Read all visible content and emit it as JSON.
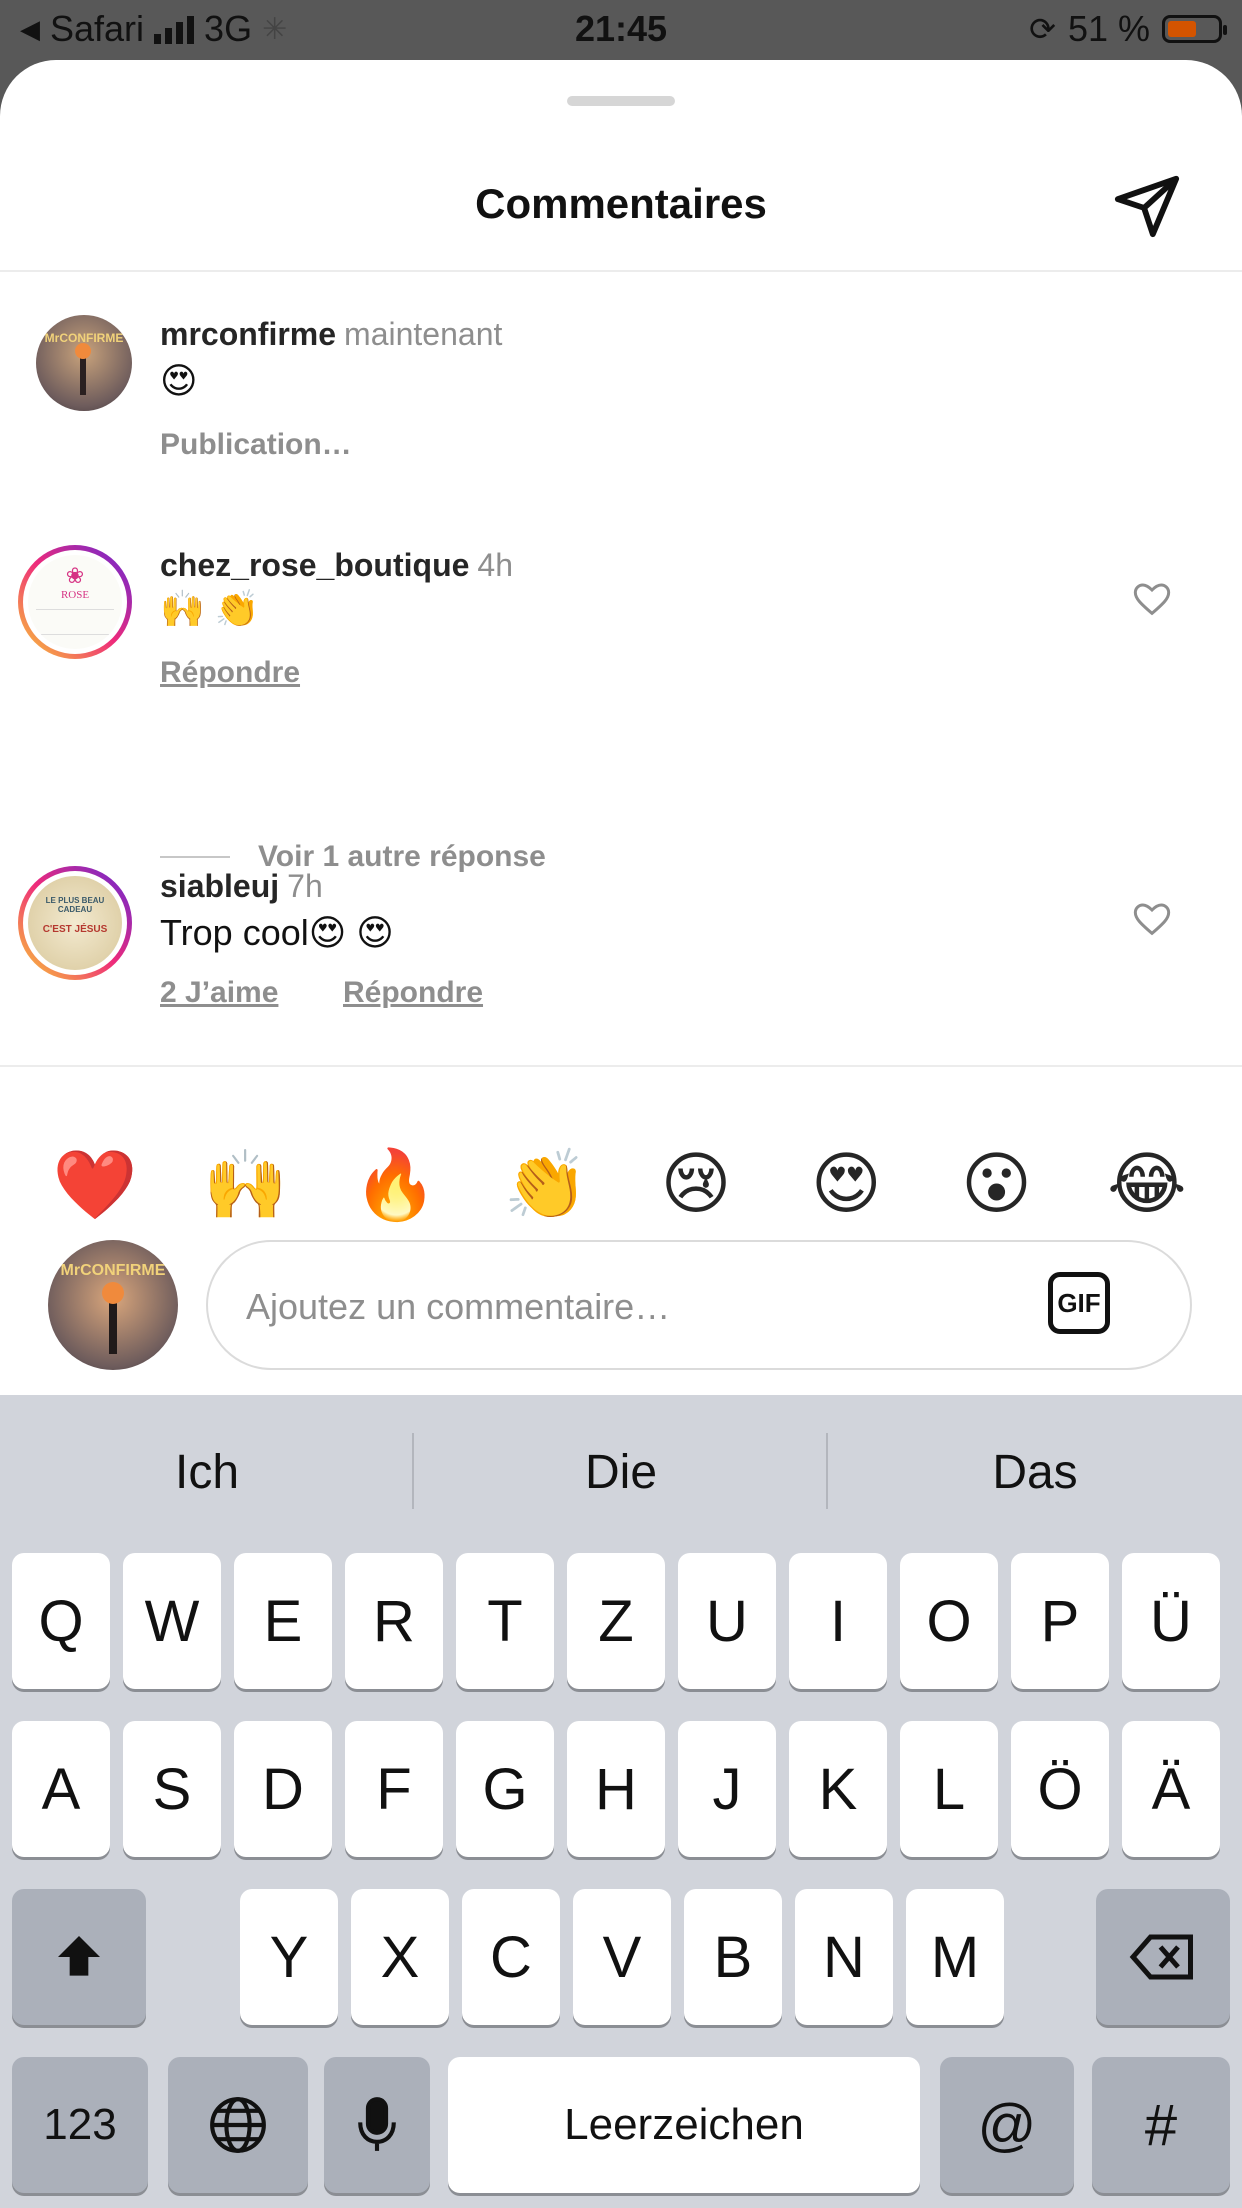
{
  "status_bar": {
    "back_app": "Safari",
    "network": "3G",
    "time": "21:45",
    "battery_percent": "51 %",
    "battery_level": 0.51
  },
  "header": {
    "title": "Commentaires"
  },
  "comments": [
    {
      "username": "mrconfirme",
      "time": "maintenant",
      "text": "😍",
      "status": "Publication…"
    },
    {
      "username": "chez_rose_boutique",
      "time": "4h",
      "text": "🙌 👏",
      "reply_label": "Répondre"
    },
    {
      "username": "siableuj",
      "time": "7h",
      "text": "Trop cool😍 😍",
      "likes_label": "2 J’aime",
      "reply_label": "Répondre"
    }
  ],
  "view_replies_label": "Voir 1 autre réponse",
  "avatar_texts": {
    "mrconfirme": "MrCONFIRME",
    "rose": "ROSE",
    "siableuj": [
      "LE PLUS BEAU CADEAU",
      "C'EST JÉSUS"
    ]
  },
  "quick_emojis": [
    "❤️",
    "🙌",
    "🔥",
    "👏",
    "😢",
    "😍",
    "😮",
    "😂"
  ],
  "composer": {
    "placeholder": "Ajoutez un commentaire…",
    "gif_label": "GIF"
  },
  "keyboard": {
    "suggestions": [
      "Ich",
      "Die",
      "Das"
    ],
    "row1": [
      "Q",
      "W",
      "E",
      "R",
      "T",
      "Z",
      "U",
      "I",
      "O",
      "P",
      "Ü"
    ],
    "row2": [
      "A",
      "S",
      "D",
      "F",
      "G",
      "H",
      "J",
      "K",
      "L",
      "Ö",
      "Ä"
    ],
    "row3": [
      "Y",
      "X",
      "C",
      "V",
      "B",
      "N",
      "M"
    ],
    "numbers_label": "123",
    "space_label": "Leerzeichen",
    "at_label": "@",
    "hash_label": "#"
  },
  "colors": {
    "accent_battery": "#d35400",
    "story_ring": "#ee2a7b",
    "keyboard_bg": "#d1d4db"
  }
}
